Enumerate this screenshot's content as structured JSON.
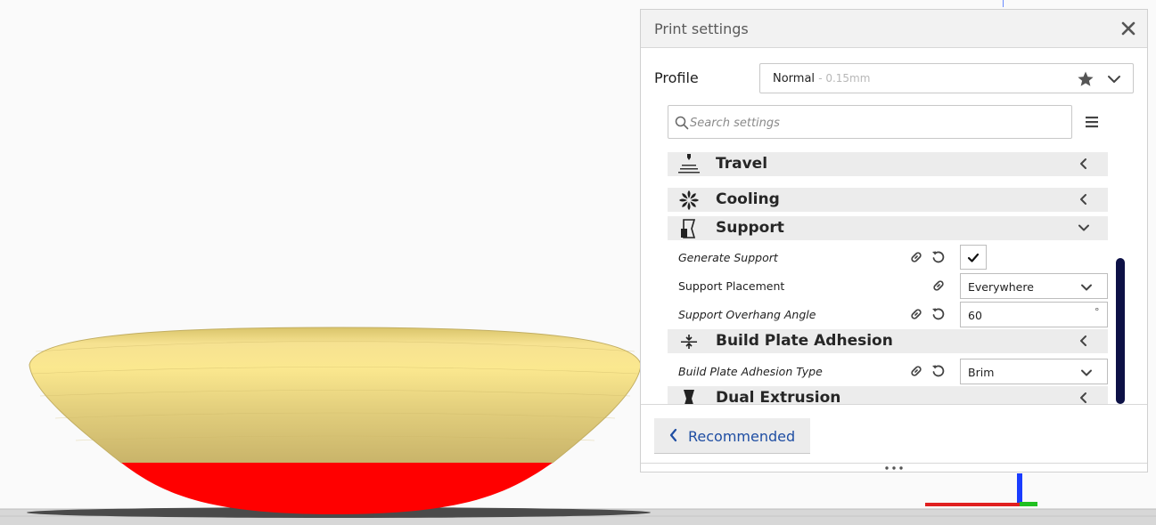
{
  "panel": {
    "title": "Print settings",
    "profile_label": "Profile",
    "profile_name": "Normal",
    "profile_detail": "- 0.15mm",
    "search_placeholder": "Search settings",
    "recommended_label": "Recommended"
  },
  "settings": {
    "categories": [
      {
        "label": "Travel",
        "icon": "travel-icon",
        "expanded": false
      },
      {
        "label": "Cooling",
        "icon": "fan-icon",
        "expanded": false
      },
      {
        "label": "Support",
        "icon": "support-icon",
        "expanded": true
      },
      {
        "label": "Build Plate Adhesion",
        "icon": "adhesion-icon",
        "expanded": false
      },
      {
        "label": "Dual Extrusion",
        "icon": "dual-extrusion-icon",
        "expanded": false
      }
    ],
    "support": {
      "generate_support": {
        "label": "Generate Support",
        "checked": true
      },
      "support_placement": {
        "label": "Support Placement",
        "value": "Everywhere"
      },
      "support_overhang_angle": {
        "label": "Support Overhang Angle",
        "value": "60",
        "unit": "°"
      }
    },
    "adhesion": {
      "adhesion_type": {
        "label": "Build Plate Adhesion Type",
        "value": "Brim"
      }
    }
  },
  "colors": {
    "model_fill": "#f2d77a",
    "overhang_fill": "#ff0000",
    "accent_blue": "#1f4ea3",
    "scrollbar": "#0d1146",
    "axis_x": "#e02020",
    "axis_y": "#20c020",
    "axis_z": "#1a3cff"
  }
}
